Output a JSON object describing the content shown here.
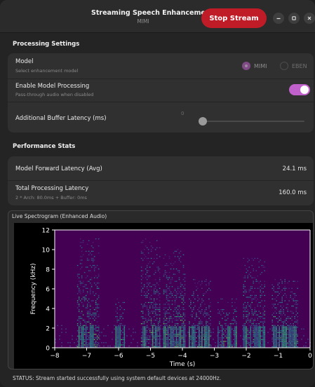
{
  "titlebar": {
    "title": "Streaming Speech Enhancement",
    "subtitle": "MIMI",
    "stop_button": "Stop Stream"
  },
  "processing": {
    "heading": "Processing Settings",
    "model": {
      "title": "Model",
      "subtitle": "Select enhancement model",
      "options": [
        "MIMI",
        "EBEN"
      ],
      "selected": "MIMI"
    },
    "enable": {
      "title": "Enable Model Processing",
      "subtitle": "Pass-through audio when disabled",
      "enabled": true
    },
    "buffer": {
      "title": "Additional Buffer Latency (ms)",
      "value": "0"
    }
  },
  "performance": {
    "heading": "Performance Stats",
    "forward_latency": {
      "title": "Model Forward Latency (Avg)",
      "value": "24.1 ms"
    },
    "total_latency": {
      "title": "Total Processing Latency",
      "subtitle": "2 * Arch: 80.0ms + Buffer: 0ms",
      "value": "160.0 ms"
    }
  },
  "spectrogram": {
    "label": "Live Spectrogram (Enhanced Audio)"
  },
  "chart_data": {
    "type": "heatmap",
    "title": "",
    "xlabel": "Time (s)",
    "ylabel": "Frequency (kHz)",
    "xlim": [
      -8,
      0
    ],
    "ylim": [
      0,
      12
    ],
    "x_ticks": [
      -8,
      -7,
      -6,
      -5,
      -4,
      -3,
      -2,
      -1,
      0
    ],
    "y_ticks": [
      0,
      2,
      4,
      6,
      8,
      10,
      12
    ],
    "colormap": "viridis",
    "background_color": "#440154",
    "speech_segments": [
      {
        "x": [
          -7.3,
          -6.6
        ],
        "max_khz": 11
      },
      {
        "x": [
          -6.1,
          -5.8
        ],
        "max_khz": 5
      },
      {
        "x": [
          -5.3,
          -4.7
        ],
        "max_khz": 11
      },
      {
        "x": [
          -4.6,
          -3.9
        ],
        "max_khz": 10
      },
      {
        "x": [
          -3.8,
          -3.1
        ],
        "max_khz": 7
      },
      {
        "x": [
          -2.9,
          -2.3
        ],
        "max_khz": 5
      },
      {
        "x": [
          -2.1,
          -1.4
        ],
        "max_khz": 9
      },
      {
        "x": [
          -1.2,
          -0.4
        ],
        "max_khz": 7
      }
    ]
  },
  "status": {
    "text": "STATUS: Stream started successfully using system default devices at 24000Hz."
  }
}
